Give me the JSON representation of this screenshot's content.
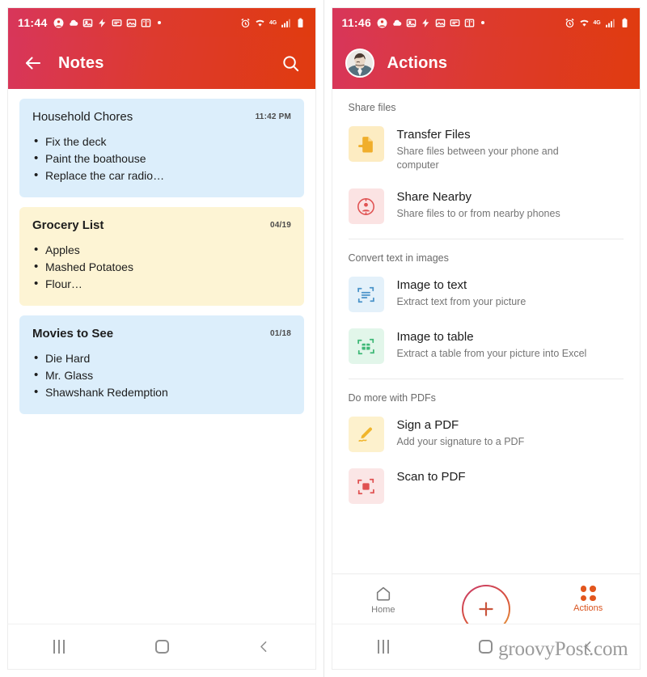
{
  "left_phone": {
    "status_bar": {
      "time": "11:44",
      "network_label": "4G",
      "icons": [
        "account-icon",
        "cloud-icon",
        "photos-icon",
        "flash-icon",
        "message-icon",
        "gallery-icon",
        "book-icon",
        "dot-icon"
      ],
      "right_icons": [
        "alarm-icon",
        "wifi-icon",
        "signal-icon",
        "battery-icon"
      ]
    },
    "app_bar": {
      "back_icon": "arrow-left-icon",
      "title": "Notes",
      "search_icon": "search-icon"
    },
    "notes": [
      {
        "title": "Household Chores",
        "timestamp": "11:42 PM",
        "color": "blue",
        "bold_title": false,
        "items": [
          "Fix the deck",
          "Paint the boathouse",
          "Replace the car radio…"
        ]
      },
      {
        "title": "Grocery List",
        "timestamp": "04/19",
        "color": "yellow",
        "bold_title": true,
        "items": [
          "Apples",
          "Mashed Potatoes",
          "Flour…"
        ]
      },
      {
        "title": "Movies to See",
        "timestamp": "01/18",
        "color": "blue",
        "bold_title": true,
        "items": [
          "Die Hard",
          "Mr. Glass",
          "Shawshank Redemption"
        ]
      }
    ],
    "nav_bar": {
      "recents_icon": "recents-icon",
      "home_icon": "home-square-icon",
      "back_icon": "chevron-left-icon"
    }
  },
  "right_phone": {
    "status_bar": {
      "time": "11:46",
      "network_label": "4G",
      "icons": [
        "account-icon",
        "cloud-icon",
        "photos-icon",
        "flash-icon",
        "gallery-icon",
        "message-icon",
        "book-icon",
        "dot-icon"
      ],
      "right_icons": [
        "alarm-icon",
        "wifi-icon",
        "signal-icon",
        "battery-icon"
      ]
    },
    "app_bar": {
      "avatar": "user-avatar",
      "title": "Actions"
    },
    "sections": [
      {
        "title": "Share files",
        "rows": [
          {
            "icon": "file-transfer-icon",
            "tile_color": "#fdecc2",
            "icon_color": "#f0ae2b",
            "title": "Transfer Files",
            "subtitle": "Share files between your phone and computer"
          },
          {
            "icon": "person-circle-icon",
            "tile_color": "#fbe3e3",
            "icon_color": "#e05252",
            "title": "Share Nearby",
            "subtitle": "Share files to or from nearby phones"
          }
        ]
      },
      {
        "title": "Convert text in images",
        "rows": [
          {
            "icon": "scan-text-icon",
            "tile_color": "#e4f1fa",
            "icon_color": "#4a93c9",
            "title": "Image to text",
            "subtitle": "Extract text from your picture"
          },
          {
            "icon": "scan-table-icon",
            "tile_color": "#e2f6ea",
            "icon_color": "#3fb877",
            "title": "Image to table",
            "subtitle": "Extract a table from your picture into Excel"
          }
        ]
      },
      {
        "title": "Do more with PDFs",
        "rows": [
          {
            "icon": "pen-signature-icon",
            "tile_color": "#fdf1cd",
            "icon_color": "#f0b52b",
            "title": "Sign a PDF",
            "subtitle": "Add your signature to a PDF"
          },
          {
            "icon": "scan-pdf-icon",
            "tile_color": "#fbe6e6",
            "icon_color": "#e05252",
            "title": "Scan to PDF",
            "subtitle": ""
          }
        ]
      }
    ],
    "tab_bar": {
      "home": {
        "icon": "home-outline-icon",
        "label": "Home",
        "active": false
      },
      "fab": {
        "icon": "plus-icon"
      },
      "actions": {
        "icon": "grid-dots-icon",
        "label": "Actions",
        "active": true
      }
    },
    "nav_bar": {
      "recents_icon": "recents-icon",
      "home_icon": "home-square-icon",
      "back_icon": "chevron-left-icon"
    }
  },
  "watermark": {
    "text": "groovyPost.com"
  },
  "colors": {
    "header_start": "#d8365b",
    "header_end": "#e03b0f",
    "accent": "#e2561d",
    "note_blue": "#dceefb",
    "note_yellow": "#fdf4d4"
  }
}
